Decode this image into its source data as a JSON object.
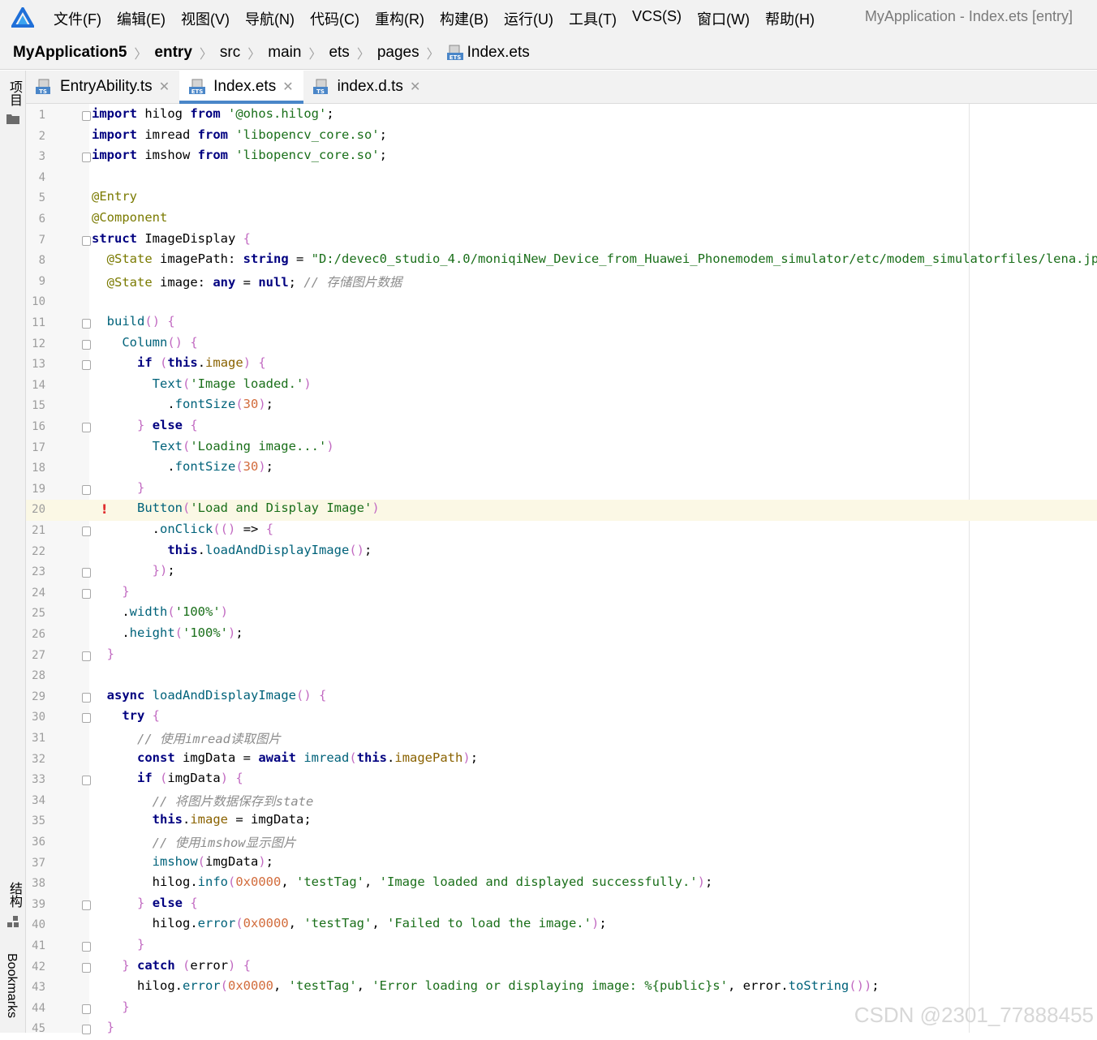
{
  "menubar": {
    "items": [
      "文件(F)",
      "编辑(E)",
      "视图(V)",
      "导航(N)",
      "代码(C)",
      "重构(R)",
      "构建(B)",
      "运行(U)",
      "工具(T)",
      "VCS(S)",
      "窗口(W)",
      "帮助(H)"
    ],
    "window_title": "MyApplication - Index.ets [entry]"
  },
  "breadcrumb": [
    "MyApplication5",
    "entry",
    "src",
    "main",
    "ets",
    "pages",
    "Index.ets"
  ],
  "side_labels": {
    "project": "项目",
    "structure": "结构",
    "bookmarks": "Bookmarks"
  },
  "tabs": [
    {
      "label": "EntryAbility.ts",
      "icon": "TS",
      "active": false
    },
    {
      "label": "Index.ets",
      "icon": "ETS",
      "active": true
    },
    {
      "label": "index.d.ts",
      "icon": "TS",
      "active": false
    }
  ],
  "editor": {
    "current_line": 20,
    "lines": [
      "import hilog from '@ohos.hilog';",
      "import imread from 'libopencv_core.so';",
      "import imshow from 'libopencv_core.so';",
      "",
      "@Entry",
      "@Component",
      "struct ImageDisplay {",
      "  @State imagePath: string = \"D:/devec0_studio_4.0/moniqiNew_Device_from_Huawei_Phonemodem_simulator/etc/modem_simulatorfiles/lena.jpg\"; /",
      "  @State image: any = null; // 存储图片数据",
      "",
      "  build() {",
      "    Column() {",
      "      if (this.image) {",
      "        Text('Image loaded.')",
      "          .fontSize(30);",
      "      } else {",
      "        Text('Loading image...')",
      "          .fontSize(30);",
      "      }",
      "      Button('Load and Display Image')",
      "        .onClick(() => {",
      "          this.loadAndDisplayImage();",
      "        });",
      "    }",
      "    .width('100%')",
      "    .height('100%');",
      "  }",
      "",
      "  async loadAndDisplayImage() {",
      "    try {",
      "      // 使用imread读取图片",
      "      const imgData = await imread(this.imagePath);",
      "      if (imgData) {",
      "        // 将图片数据保存到state",
      "        this.image = imgData;",
      "        // 使用imshow显示图片",
      "        imshow(imgData);",
      "        hilog.info(0x0000, 'testTag', 'Image loaded and displayed successfully.');",
      "      } else {",
      "        hilog.error(0x0000, 'testTag', 'Failed to load the image.');",
      "      }",
      "    } catch (error) {",
      "      hilog.error(0x0000, 'testTag', 'Error loading or displaying image: %{public}s', error.toString());",
      "    }",
      "  }"
    ]
  },
  "watermark": "CSDN @2301_77888455",
  "colors": {
    "accent": "#4a86c8",
    "current_line": "#fbf8e5",
    "error": "#e02f2f"
  }
}
